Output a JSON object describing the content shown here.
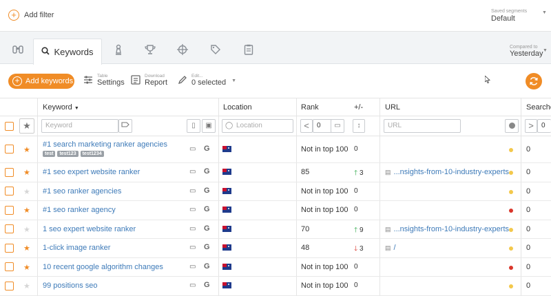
{
  "filter_bar": {
    "add_filter": "Add filter",
    "saved_segments_label": "Saved segments",
    "saved_segments_value": "Default"
  },
  "tabs": {
    "active_label": "Keywords",
    "compared_label": "Compared to",
    "compared_value": "Yesterday"
  },
  "toolbar": {
    "add_keywords": "Add keywords",
    "table_small": "Table",
    "table_big": "Settings",
    "download_small": "Download",
    "download_big": "Report",
    "edit_small": "Edit...",
    "edit_big": "0 selected"
  },
  "table": {
    "headers": {
      "keyword": "Keyword",
      "location": "Location",
      "rank": "Rank",
      "change": "+/-",
      "url": "URL",
      "searches": "Searche"
    },
    "filters": {
      "keyword_placeholder": "Keyword",
      "location_placeholder": "Location",
      "rank_value": "0",
      "url_placeholder": "URL",
      "searches_value": "0"
    },
    "rows": [
      {
        "keyword": "#1 search marketing ranker agencies",
        "starred": true,
        "tags": [
          "test",
          "test123",
          "test1234"
        ],
        "rank": "Not in top 100",
        "change": "0",
        "dir": "none",
        "url": "",
        "status": "yellow",
        "searches": "0"
      },
      {
        "keyword": "#1 seo expert website ranker",
        "starred": true,
        "tags": [],
        "rank": "85",
        "change": "3",
        "dir": "up",
        "url": "...nsights-from-10-industry-experts",
        "status": "yellow",
        "searches": "0"
      },
      {
        "keyword": "#1 seo ranker agencies",
        "starred": false,
        "tags": [],
        "rank": "Not in top 100",
        "change": "0",
        "dir": "none",
        "url": "",
        "status": "yellow",
        "searches": "0"
      },
      {
        "keyword": "#1 seo ranker agency",
        "starred": true,
        "tags": [],
        "rank": "Not in top 100",
        "change": "0",
        "dir": "none",
        "url": "",
        "status": "red",
        "searches": "0"
      },
      {
        "keyword": "1 seo expert website ranker",
        "starred": false,
        "tags": [],
        "rank": "70",
        "change": "9",
        "dir": "up",
        "url": "...nsights-from-10-industry-experts",
        "status": "yellow",
        "searches": "0"
      },
      {
        "keyword": "1-click image ranker",
        "starred": true,
        "tags": [],
        "rank": "48",
        "change": "3",
        "dir": "down",
        "url": "/",
        "status": "yellow",
        "searches": "0"
      },
      {
        "keyword": "10 recent google algorithm changes",
        "starred": true,
        "tags": [],
        "rank": "Not in top 100",
        "change": "0",
        "dir": "none",
        "url": "",
        "status": "red",
        "searches": "0"
      },
      {
        "keyword": "99 positions seo",
        "starred": false,
        "tags": [],
        "rank": "Not in top 100",
        "change": "0",
        "dir": "none",
        "url": "",
        "status": "yellow",
        "searches": "0"
      }
    ]
  },
  "colors": {
    "accent": "#f08c26",
    "link": "#3d7ab8",
    "up": "#2ea84a",
    "down": "#d9362b"
  }
}
